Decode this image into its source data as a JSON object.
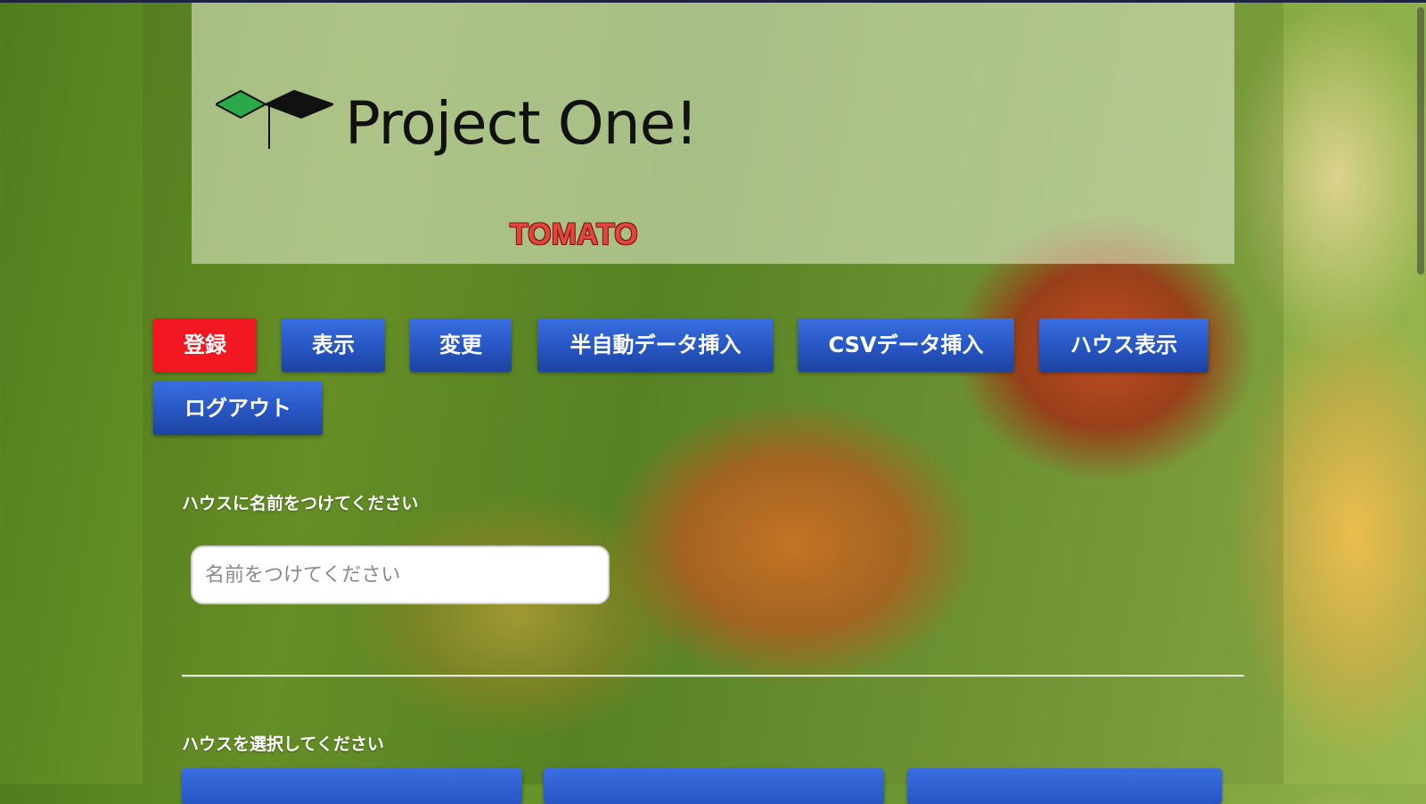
{
  "header": {
    "logo_text": "Project One!",
    "subtitle": "TOMATO"
  },
  "nav": {
    "buttons": [
      {
        "label": "登録",
        "active": true
      },
      {
        "label": "表示",
        "active": false
      },
      {
        "label": "変更",
        "active": false
      },
      {
        "label": "半自動データ挿入",
        "active": false
      },
      {
        "label": "CSVデータ挿入",
        "active": false
      },
      {
        "label": "ハウス表示",
        "active": false
      },
      {
        "label": "ログアウト",
        "active": false
      }
    ]
  },
  "form": {
    "house_name_label": "ハウスに名前をつけてください",
    "house_name_input": {
      "value": "",
      "placeholder": "名前をつけてください"
    }
  },
  "house_select": {
    "label": "ハウスを選択してください"
  },
  "colors": {
    "active_button": "#f11822",
    "button_blue": "#2756c4",
    "subtitle_red": "#e2453a",
    "logo_leaf_green": "#2aa84a"
  }
}
